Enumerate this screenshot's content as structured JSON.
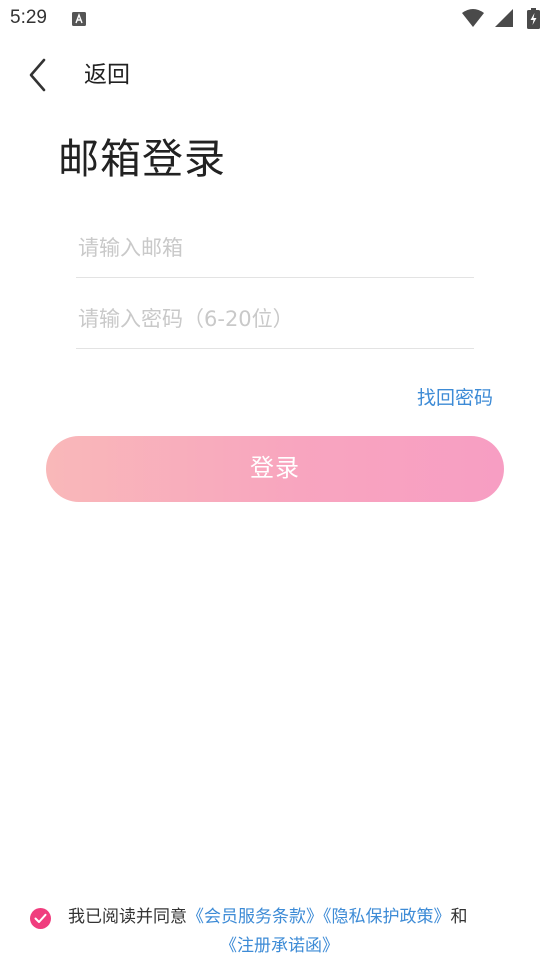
{
  "status_bar": {
    "time": "5:29",
    "app_icon": "a-text-icon",
    "icons": [
      "wifi-icon",
      "signal-icon",
      "battery-charging-icon"
    ]
  },
  "nav": {
    "back_icon": "chevron-left-icon",
    "back_label": "返回"
  },
  "page": {
    "title": "邮箱登录"
  },
  "form": {
    "email_placeholder": "请输入邮箱",
    "email_value": "",
    "password_placeholder": "请输入密码（6-20位）",
    "password_value": "",
    "forgot_password": "找回密码",
    "login_button": "登录"
  },
  "agreement": {
    "checked": true,
    "check_icon": "check-circle-icon",
    "prefix": "我已阅读并同意",
    "membership_terms": "《会员服务条款》",
    "privacy_policy": "《隐私保护政策》",
    "conjunction": "和",
    "registration_letter": "《注册承诺函》"
  },
  "colors": {
    "accent_link": "#3d8bd6",
    "check_pink": "#f03d7e",
    "button_gradient_start": "#f9b8b9",
    "button_gradient_end": "#f79ec3"
  }
}
